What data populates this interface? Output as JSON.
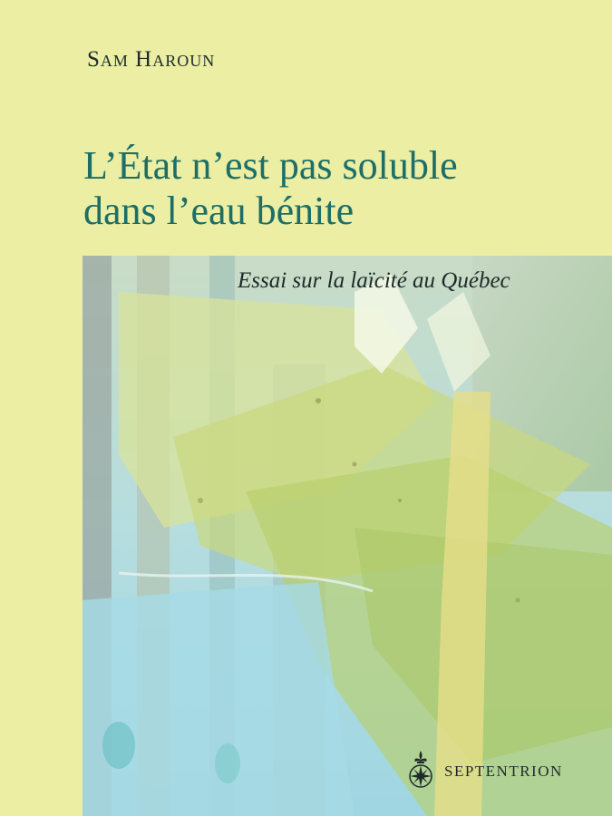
{
  "cover": {
    "author": "Sam Haroun",
    "title_line1": "L’État n’est pas soluble",
    "title_line2": "dans l’eau bénite",
    "subtitle": "Essai sur la laïcité au Québec",
    "publisher": "SEPTENTRION",
    "publisher_logo_icon": "fleur-de-lis-compass-icon"
  },
  "colors": {
    "background": "#ebeea3",
    "title": "#1d6e66",
    "text": "#1e2a2a"
  }
}
